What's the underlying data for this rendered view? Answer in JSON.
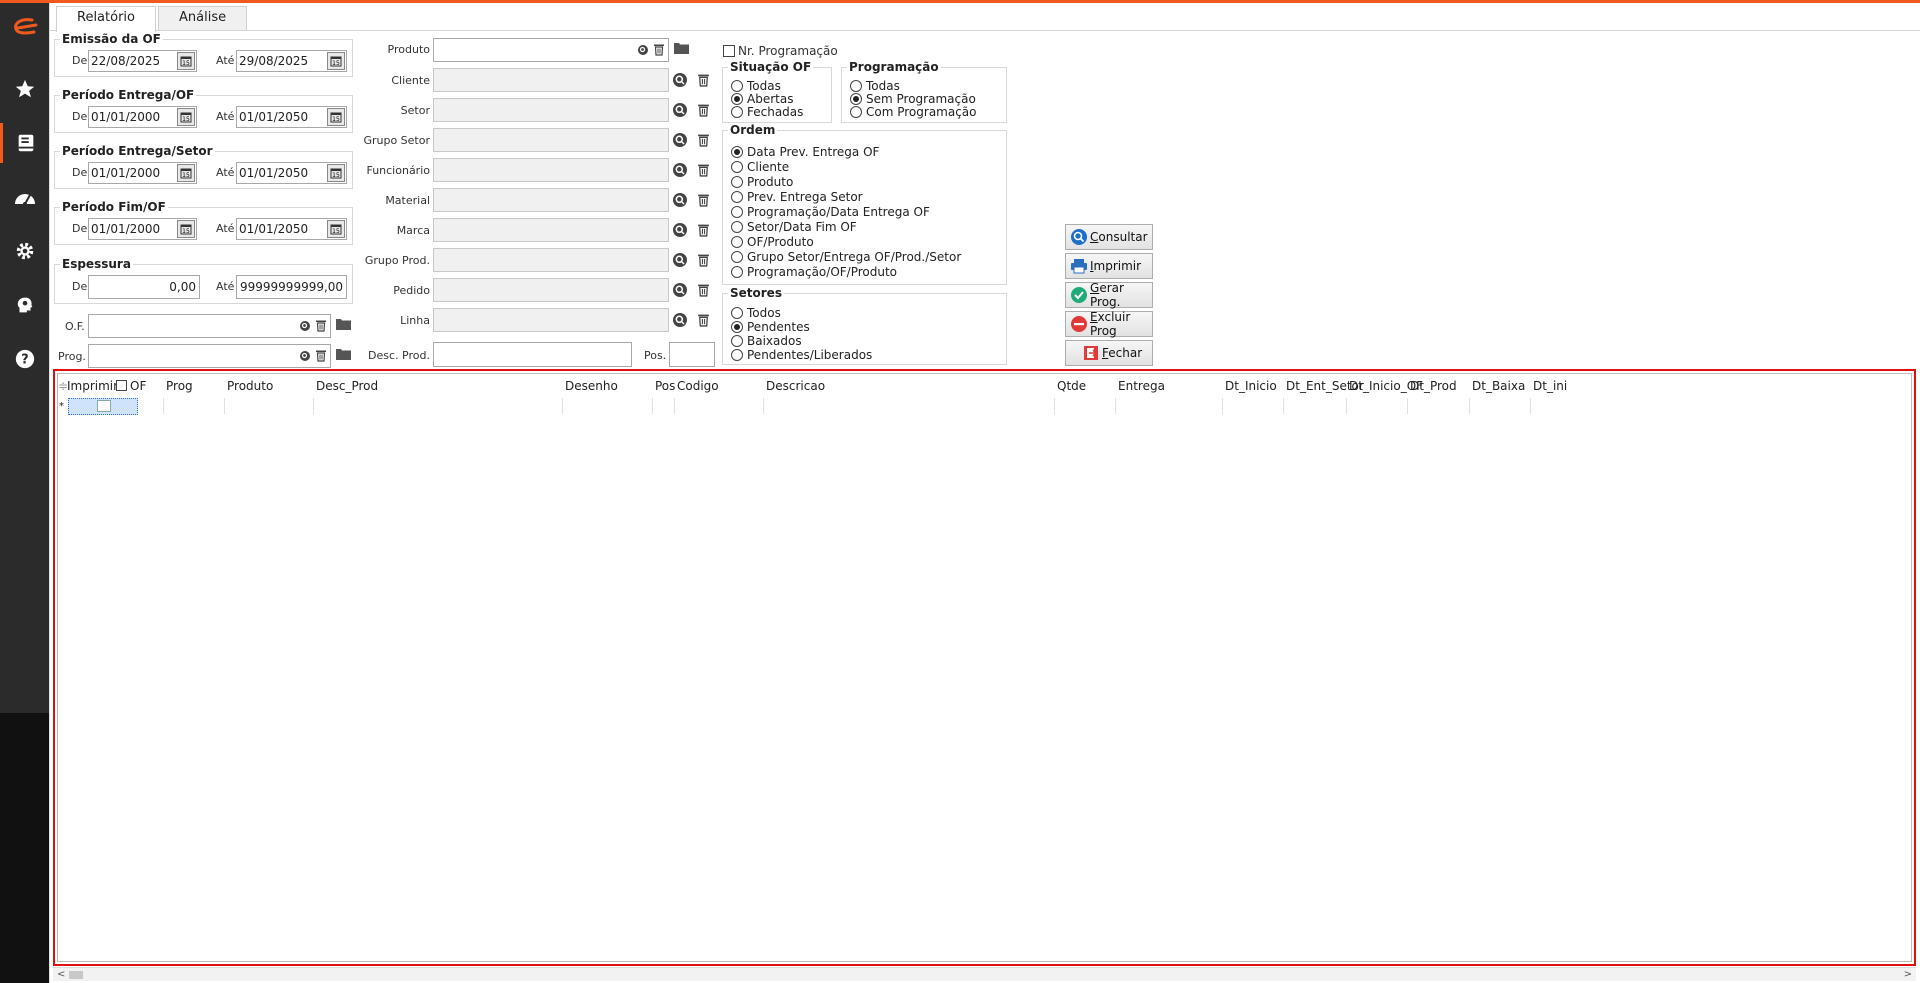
{
  "tabs": [
    {
      "label": "Relatório",
      "active": true
    },
    {
      "label": "Análise",
      "active": false
    }
  ],
  "emissao": {
    "title": "Emissão da OF",
    "de_label": "De",
    "de": "22/08/2025",
    "ate_label": "Até",
    "ate": "29/08/2025"
  },
  "periodo_entrega_of": {
    "title": "Período Entrega/OF",
    "de_label": "De",
    "de": "01/01/2000",
    "ate_label": "Até",
    "ate": "01/01/2050"
  },
  "periodo_entrega_setor": {
    "title": "Período Entrega/Setor",
    "de_label": "De",
    "de": "01/01/2000",
    "ate_label": "Até",
    "ate": "01/01/2050"
  },
  "periodo_fim_of": {
    "title": "Período Fim/OF",
    "de_label": "De",
    "de": "01/01/2000",
    "ate_label": "Até",
    "ate": "01/01/2050"
  },
  "espessura": {
    "title": "Espessura",
    "de_label": "De",
    "de": "0,00",
    "ate_label": "Até",
    "ate": "99999999999,00"
  },
  "of_label": "O.F.",
  "prog_label": "Prog.",
  "filters": {
    "produto": "Produto",
    "cliente": "Cliente",
    "setor": "Setor",
    "grupo_setor": "Grupo Setor",
    "funcionario": "Funcionário",
    "material": "Material",
    "marca": "Marca",
    "grupo_prod": "Grupo Prod.",
    "pedido": "Pedido",
    "linha": "Linha",
    "desc_prod": "Desc. Prod.",
    "pos": "Pos."
  },
  "nr_programacao": {
    "label": "Nr. Programação",
    "checked": false
  },
  "situacao_of": {
    "title": "Situação OF",
    "options": [
      {
        "label": "Todas",
        "selected": false
      },
      {
        "label": "Abertas",
        "selected": true
      },
      {
        "label": "Fechadas",
        "selected": false
      }
    ]
  },
  "programacao": {
    "title": "Programação",
    "options": [
      {
        "label": "Todas",
        "selected": false
      },
      {
        "label": "Sem Programação",
        "selected": true
      },
      {
        "label": "Com Programação",
        "selected": false
      }
    ]
  },
  "ordem": {
    "title": "Ordem",
    "options": [
      {
        "label": "Data Prev. Entrega OF",
        "selected": true
      },
      {
        "label": "Cliente",
        "selected": false
      },
      {
        "label": "Produto",
        "selected": false
      },
      {
        "label": "Prev. Entrega Setor",
        "selected": false
      },
      {
        "label": "Programação/Data Entrega OF",
        "selected": false
      },
      {
        "label": "Setor/Data Fim OF",
        "selected": false
      },
      {
        "label": "OF/Produto",
        "selected": false
      },
      {
        "label": "Grupo Setor/Entrega OF/Prod./Setor",
        "selected": false
      },
      {
        "label": "Programação/OF/Produto",
        "selected": false
      }
    ]
  },
  "setores": {
    "title": "Setores",
    "options": [
      {
        "label": "Todos",
        "selected": false
      },
      {
        "label": "Pendentes",
        "selected": true
      },
      {
        "label": "Baixados",
        "selected": false
      },
      {
        "label": "Pendentes/Liberados",
        "selected": false
      }
    ]
  },
  "buttons": {
    "consultar": {
      "u": "C",
      "rest": "onsultar"
    },
    "imprimir": {
      "u": "I",
      "rest": "mprimir"
    },
    "gerar": {
      "u": "G",
      "rest": "erar Prog."
    },
    "excluir": {
      "u": "E",
      "rest": "xcluir Prog"
    },
    "fechar": {
      "u": "F",
      "rest": "echar"
    }
  },
  "grid": {
    "columns": [
      "Imprimir",
      "OF",
      "Prog",
      "Produto",
      "Desc_Prod",
      "Desenho",
      "Pos",
      "Codigo",
      "Descricao",
      "Qtde",
      "Entrega",
      "Dt_Inicio",
      "Dt_Ent_Setor",
      "Dt_Inicio_OF",
      "Dt_Prod",
      "Dt_Baixa",
      "Dt_ini"
    ],
    "new_row_marker": "*"
  },
  "colors": {
    "accent": "#f05a1e",
    "sidebar": "#2b2b2b",
    "grid_border": "#e01010"
  }
}
